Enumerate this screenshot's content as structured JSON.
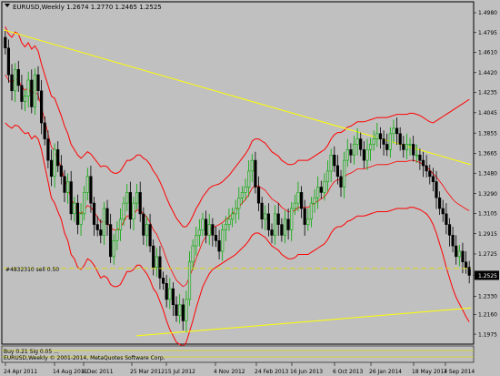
{
  "header": {
    "symbol_line": "EURUSD,Weekly  1.2674 1.2770 1.2465 1.2525"
  },
  "order_label": "#4832310 sell 0.50",
  "footer_lines": {
    "indicator_line": "Buy 0.21 Sig 0.05 ...",
    "copyright_line": "EURUSD,Weekly © 2001-2014, MetaQuotes Software Corp."
  },
  "colors": {
    "background": "#c0c0c0",
    "bull_candle": "#00aa00",
    "bear_candle": "#000000",
    "bands": "#ff0000",
    "trendline": "#ffff00",
    "order_line": "#dddd00",
    "price_box": "#000000"
  },
  "chart_data": {
    "type": "candlestick",
    "title": "EURUSD,Weekly",
    "ohlc_last": {
      "open": 1.2674,
      "high": 1.277,
      "low": 1.2465,
      "close": 1.2525
    },
    "ylim": [
      1.195,
      1.498
    ],
    "y_ticks": [
      "1.4980",
      "1.4795",
      "1.4610",
      "1.4420",
      "1.4235",
      "1.4045",
      "1.3855",
      "1.3665",
      "1.3480",
      "1.3290",
      "1.3105",
      "1.2915",
      "1.2725",
      "1.2525",
      "1.2330",
      "1.2160",
      "1.1975"
    ],
    "x_ticks": [
      "24 Apr 2011",
      "14 Aug 2011",
      "4 Dec 2011",
      "25 Mar 2012",
      "15 Jul 2012",
      "4 Nov 2012",
      "24 Feb 2013",
      "16 Jun 2013",
      "6 Oct 2013",
      "26 Jan 2014",
      "18 May 2014",
      "7 Sep 2014"
    ],
    "current_price": 1.2525,
    "order_price": 1.259,
    "closes": [
      1.465,
      1.44,
      1.425,
      1.445,
      1.43,
      1.415,
      1.42,
      1.435,
      1.41,
      1.44,
      1.425,
      1.395,
      1.38,
      1.36,
      1.345,
      1.37,
      1.355,
      1.345,
      1.33,
      1.34,
      1.31,
      1.32,
      1.3,
      1.31,
      1.33,
      1.345,
      1.32,
      1.3,
      1.295,
      1.29,
      1.315,
      1.3,
      1.27,
      1.285,
      1.295,
      1.305,
      1.32,
      1.33,
      1.305,
      1.32,
      1.33,
      1.31,
      1.29,
      1.3,
      1.28,
      1.26,
      1.27,
      1.25,
      1.245,
      1.23,
      1.24,
      1.225,
      1.215,
      1.225,
      1.21,
      1.23,
      1.265,
      1.28,
      1.29,
      1.295,
      1.305,
      1.29,
      1.3,
      1.29,
      1.285,
      1.275,
      1.295,
      1.3,
      1.305,
      1.31,
      1.315,
      1.325,
      1.33,
      1.335,
      1.35,
      1.36,
      1.335,
      1.32,
      1.305,
      1.31,
      1.295,
      1.29,
      1.31,
      1.3,
      1.29,
      1.305,
      1.295,
      1.315,
      1.32,
      1.33,
      1.315,
      1.3,
      1.305,
      1.32,
      1.325,
      1.335,
      1.33,
      1.34,
      1.35,
      1.365,
      1.355,
      1.345,
      1.335,
      1.36,
      1.37,
      1.365,
      1.375,
      1.38,
      1.37,
      1.36,
      1.37,
      1.375,
      1.38,
      1.385,
      1.38,
      1.375,
      1.37,
      1.385,
      1.39,
      1.385,
      1.375,
      1.37,
      1.375,
      1.375,
      1.365,
      1.365,
      1.36,
      1.355,
      1.35,
      1.345,
      1.34,
      1.325,
      1.315,
      1.31,
      1.3,
      1.29,
      1.28,
      1.27,
      1.275,
      1.265,
      1.26,
      1.2525
    ],
    "bands_upper": [
      1.485,
      1.478,
      1.475,
      1.48,
      1.478,
      1.47,
      1.466,
      1.47,
      1.464,
      1.467,
      1.462,
      1.45,
      1.44,
      1.43,
      1.42,
      1.418,
      1.41,
      1.402,
      1.392,
      1.385,
      1.375,
      1.37,
      1.365,
      1.362,
      1.365,
      1.368,
      1.366,
      1.362,
      1.358,
      1.354,
      1.355,
      1.354,
      1.35,
      1.348,
      1.348,
      1.35,
      1.355,
      1.36,
      1.36,
      1.362,
      1.365,
      1.365,
      1.362,
      1.36,
      1.356,
      1.35,
      1.346,
      1.34,
      1.333,
      1.325,
      1.318,
      1.312,
      1.306,
      1.302,
      1.298,
      1.298,
      1.302,
      1.308,
      1.315,
      1.32,
      1.326,
      1.33,
      1.334,
      1.336,
      1.337,
      1.338,
      1.34,
      1.343,
      1.346,
      1.35,
      1.354,
      1.358,
      1.362,
      1.366,
      1.371,
      1.378,
      1.38,
      1.38,
      1.378,
      1.376,
      1.372,
      1.368,
      1.366,
      1.364,
      1.36,
      1.358,
      1.356,
      1.356,
      1.357,
      1.36,
      1.36,
      1.36,
      1.36,
      1.362,
      1.364,
      1.366,
      1.368,
      1.37,
      1.374,
      1.38,
      1.384,
      1.386,
      1.386,
      1.388,
      1.391,
      1.392,
      1.394,
      1.396,
      1.396,
      1.396,
      1.397,
      1.398,
      1.399,
      1.4,
      1.4,
      1.4,
      1.4,
      1.401,
      1.402,
      1.403,
      1.403,
      1.403,
      1.403,
      1.404,
      1.404,
      1.403,
      1.402,
      1.4,
      1.398,
      1.396,
      1.395,
      1.397,
      1.399,
      1.401,
      1.403,
      1.405,
      1.407,
      1.409,
      1.411,
      1.413,
      1.415,
      1.417
    ],
    "bands_lower": [
      1.395,
      1.392,
      1.39,
      1.393,
      1.392,
      1.388,
      1.385,
      1.386,
      1.38,
      1.383,
      1.38,
      1.37,
      1.355,
      1.34,
      1.325,
      1.32,
      1.312,
      1.305,
      1.292,
      1.285,
      1.272,
      1.268,
      1.26,
      1.258,
      1.262,
      1.268,
      1.266,
      1.262,
      1.256,
      1.25,
      1.252,
      1.25,
      1.244,
      1.242,
      1.242,
      1.244,
      1.25,
      1.256,
      1.256,
      1.258,
      1.262,
      1.262,
      1.258,
      1.254,
      1.248,
      1.24,
      1.236,
      1.228,
      1.22,
      1.21,
      1.202,
      1.196,
      1.19,
      1.188,
      1.186,
      1.19,
      1.2,
      1.21,
      1.222,
      1.232,
      1.242,
      1.248,
      1.254,
      1.258,
      1.26,
      1.262,
      1.264,
      1.266,
      1.268,
      1.27,
      1.272,
      1.275,
      1.278,
      1.281,
      1.285,
      1.29,
      1.292,
      1.292,
      1.29,
      1.288,
      1.284,
      1.28,
      1.278,
      1.276,
      1.272,
      1.27,
      1.268,
      1.268,
      1.269,
      1.272,
      1.272,
      1.272,
      1.272,
      1.274,
      1.276,
      1.278,
      1.28,
      1.282,
      1.286,
      1.292,
      1.296,
      1.298,
      1.298,
      1.3,
      1.303,
      1.304,
      1.306,
      1.308,
      1.308,
      1.308,
      1.309,
      1.31,
      1.311,
      1.312,
      1.312,
      1.312,
      1.312,
      1.313,
      1.314,
      1.315,
      1.315,
      1.315,
      1.315,
      1.316,
      1.316,
      1.315,
      1.314,
      1.312,
      1.31,
      1.306,
      1.3,
      1.292,
      1.282,
      1.272,
      1.26,
      1.25,
      1.24,
      1.232,
      1.226,
      1.22,
      1.214,
      1.209
    ]
  }
}
